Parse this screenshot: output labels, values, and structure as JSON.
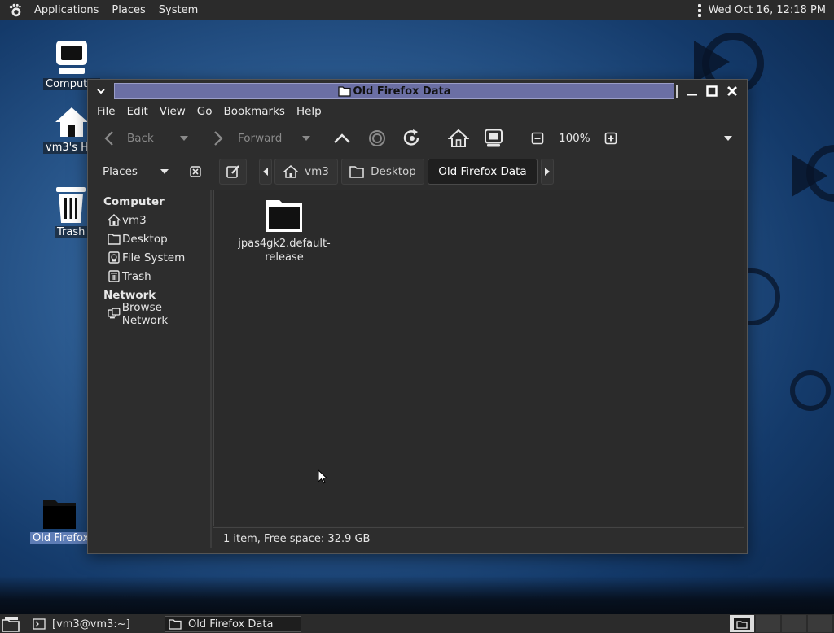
{
  "top_panel": {
    "menus": [
      "Applications",
      "Places",
      "System"
    ],
    "clock": "Wed Oct 16, 12:18 PM"
  },
  "desktop_icons": [
    {
      "label": "Computer",
      "icon": "computer-icon"
    },
    {
      "label": "vm3's Home",
      "icon": "home-icon"
    },
    {
      "label": "Trash",
      "icon": "trash-icon"
    },
    {
      "label": "Old Firefox Data",
      "icon": "folder-icon",
      "selected": true
    }
  ],
  "window": {
    "title": "Old Firefox Data",
    "menubar": [
      "File",
      "Edit",
      "View",
      "Go",
      "Bookmarks",
      "Help"
    ],
    "toolbar": {
      "back_label": "Back",
      "forward_label": "Forward",
      "zoom": "100%"
    },
    "pathbar": {
      "places_label": "Places",
      "crumbs": [
        "vm3",
        "Desktop",
        "Old Firefox Data"
      ]
    },
    "sidebar": {
      "sections": [
        {
          "title": "Computer",
          "items": [
            {
              "label": "vm3",
              "icon": "home-icon"
            },
            {
              "label": "Desktop",
              "icon": "folder-icon"
            },
            {
              "label": "File System",
              "icon": "drive-icon"
            },
            {
              "label": "Trash",
              "icon": "trash-icon"
            }
          ]
        },
        {
          "title": "Network",
          "items": [
            {
              "label": "Browse Network",
              "icon": "network-icon"
            }
          ]
        }
      ]
    },
    "files": [
      {
        "name_line1": "jpas4gk2.default-",
        "name_line2": "release",
        "icon": "folder-icon"
      }
    ],
    "status": "1 item, Free space: 32.9 GB"
  },
  "taskbar": {
    "tasks": [
      "[vm3@vm3:~]",
      "Old Firefox Data"
    ]
  },
  "colors": {
    "panel": "#2b2b2b",
    "window_bg": "#2d2d2d",
    "title_active": "#6b6fa4",
    "selection": "#5e7db6"
  }
}
